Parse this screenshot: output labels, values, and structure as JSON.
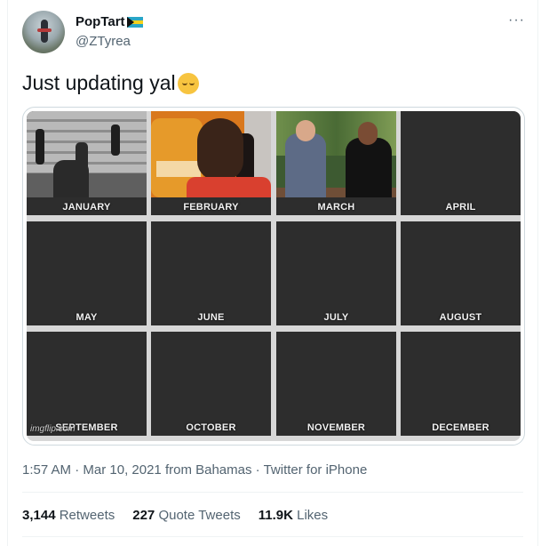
{
  "author": {
    "display_name": "PopTart",
    "handle": "@ZTyrea",
    "flag": "Bahamas flag"
  },
  "more_icon": "more-icon",
  "tweet": {
    "text": "Just updating yal",
    "emoji": "relieved-face"
  },
  "media": {
    "months": [
      "JANUARY",
      "FEBRUARY",
      "MARCH",
      "APRIL",
      "MAY",
      "JUNE",
      "JULY",
      "AUGUST",
      "SEPTEMBER",
      "OCTOBER",
      "NOVEMBER",
      "DECEMBER"
    ],
    "watermark": "imgflip.com"
  },
  "meta": {
    "time": "1:57 AM",
    "date": "Mar 10, 2021",
    "location": "from Bahamas",
    "source": "Twitter for iPhone"
  },
  "stats": {
    "retweets_count": "3,144",
    "retweets_label": "Retweets",
    "quotes_count": "227",
    "quotes_label": "Quote Tweets",
    "likes_count": "11.9K",
    "likes_label": "Likes"
  }
}
